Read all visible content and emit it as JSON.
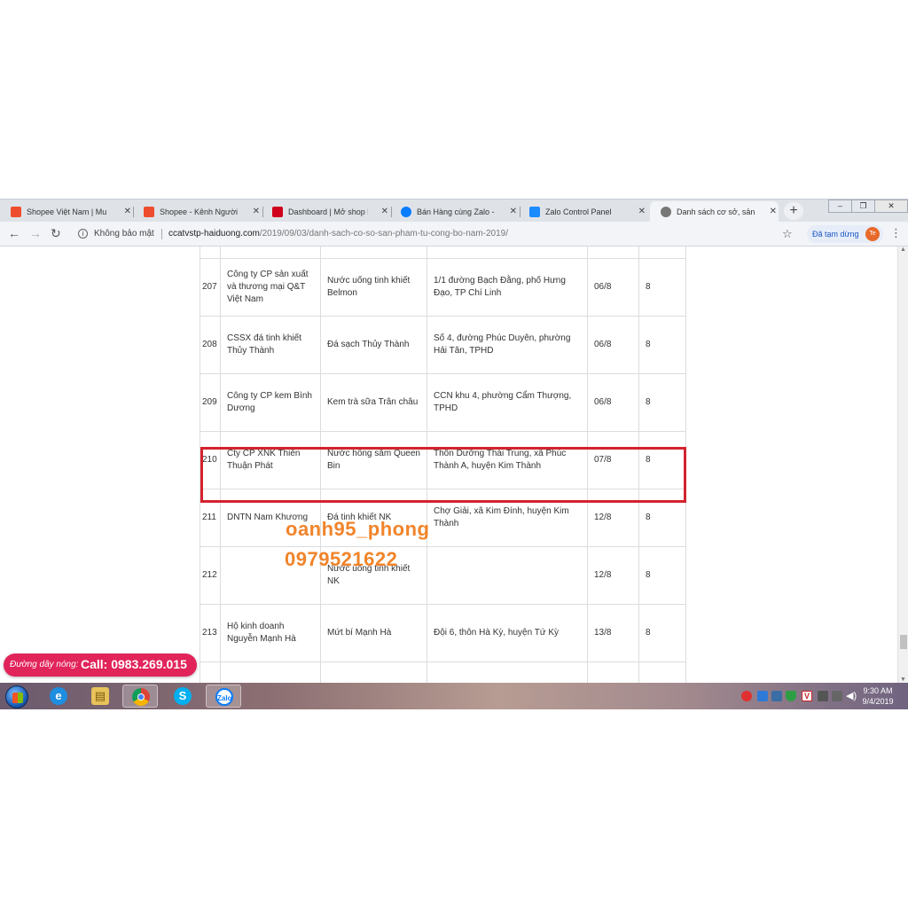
{
  "browser": {
    "tabs": [
      {
        "title": "Shopee Việt Nam | Mua",
        "color": "#ee4d2d"
      },
      {
        "title": "Shopee - Kênh Người bá",
        "color": "#ee4d2d"
      },
      {
        "title": "Dashboard | Mở shop b",
        "color": "#d0011b"
      },
      {
        "title": "Bán Hàng cùng Zalo - Za",
        "color": "#0a7cff"
      },
      {
        "title": "Zalo Control Panel",
        "color": "#1a8cff"
      },
      {
        "title": "Danh sách cơ sở, sản ph",
        "color": "#666666"
      }
    ],
    "tab_close": "✕",
    "new_tab": "+",
    "security_label": "Không bảo mật",
    "url_host": "ccatvstp-haiduong.com",
    "url_path": "/2019/09/03/danh-sach-co-so-san-pham-tu-cong-bo-nam-2019/",
    "profile_status": "Đã tạm dừng",
    "profile_initials": "Te"
  },
  "table": {
    "rows": [
      {
        "no": "",
        "company": "",
        "product": "",
        "address": "",
        "date": "",
        "qty": ""
      },
      {
        "no": "207",
        "company": "Công ty CP sản xuất và thương mại Q&T Việt Nam",
        "product": "Nước uống tinh khiết Belmon",
        "address": "1/1 đường Bạch Đằng, phố Hưng Đạo, TP Chí Linh",
        "date": "06/8",
        "qty": "8"
      },
      {
        "no": "208",
        "company": "CSSX đá tinh khiết Thủy Thành",
        "product": "Đá sạch Thủy Thành",
        "address": "Số 4, đường Phúc Duyên, phường Hải Tân, TPHD",
        "date": "06/8",
        "qty": "8"
      },
      {
        "no": "209",
        "company": "Công ty CP kem Bình Dương",
        "product": "Kem trà sữa Trân châu",
        "address": "CCN khu 4, phường Cẩm Thượng, TPHD",
        "date": "06/8",
        "qty": "8"
      },
      {
        "no": "210",
        "company": "Cty CP XNK Thiên Thuận Phát",
        "product": "Nước hồng sâm Queen Bin",
        "address": "Thôn Dưỡng Thái Trung, xã Phúc Thành A, huyện Kim Thành",
        "date": "07/8",
        "qty": "8"
      },
      {
        "no": "211",
        "company": "DNTN Nam Khương",
        "product": "Đá tinh khiết NK",
        "address": "Chợ Giải, xã Kim Đính, huyện Kim Thành",
        "date": "12/8",
        "qty": "8"
      },
      {
        "no": "212",
        "company": "",
        "product": "Nước uống tinh khiết NK",
        "address": "",
        "date": "12/8",
        "qty": "8"
      },
      {
        "no": "213",
        "company": "Hộ kinh doanh Nguyễn Mạnh Hà",
        "product": "Mứt bí Mạnh Hà",
        "address": "Đội 6, thôn Hà Kỳ, huyện Tứ Kỳ",
        "date": "13/8",
        "qty": "8"
      },
      {
        "no": "",
        "company": "",
        "product": "",
        "address": "",
        "date": "",
        "qty": ""
      }
    ]
  },
  "watermark": {
    "line1": "oanh95_phong",
    "line2": "0979521622"
  },
  "hotline": {
    "label": "Đường dây nóng:",
    "call": "Call: 0983.269.015"
  },
  "taskbar": {
    "clock_time": "9:30 AM",
    "clock_date": "9/4/2019",
    "apps": [
      "internet-explorer",
      "file-explorer",
      "chrome",
      "skype",
      "zalo"
    ],
    "zalo_label": "Zalo"
  }
}
